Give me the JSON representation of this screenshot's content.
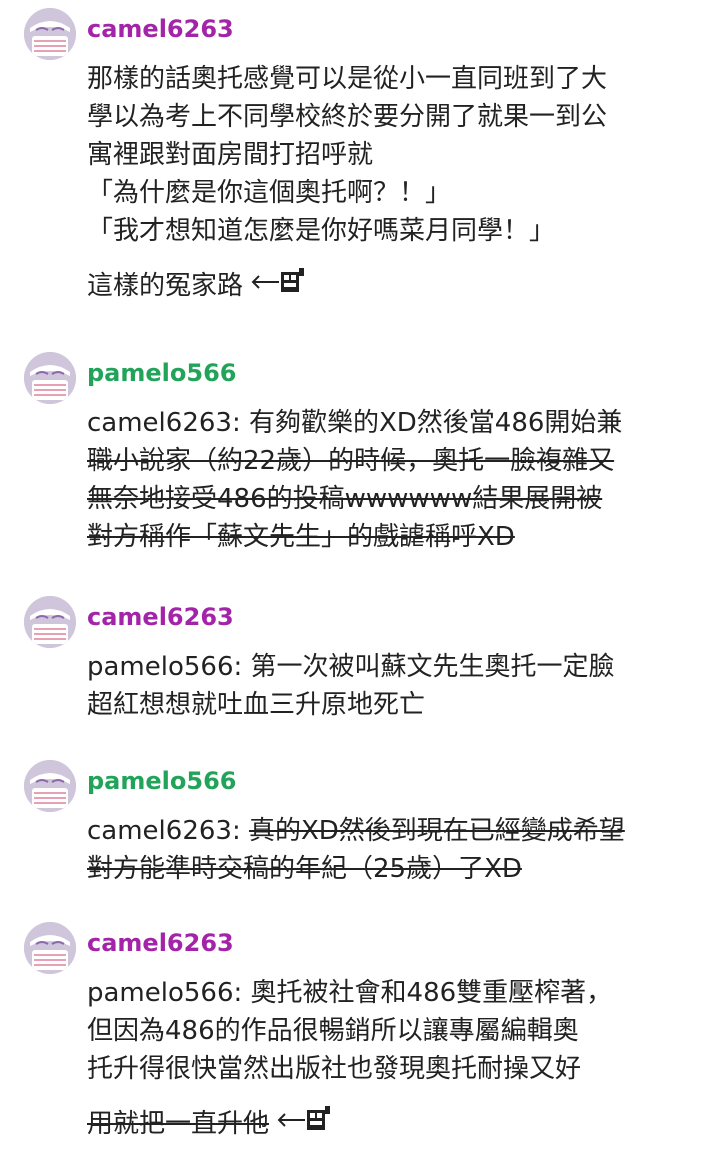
{
  "colors": {
    "camel": "#a324a9",
    "pamelo": "#22a35a",
    "avatar_bg": "#cfc6dc",
    "avatar_face": "#ffffff",
    "avatar_accent": "#e8a0b4"
  },
  "comments": [
    {
      "username": "camel6263",
      "lines": [
        "那樣的話奧托感覺可以是從小一直同班到了大",
        "學以為考上不同學校終於要分開了就果一到公",
        "寓裡跟對面房間打招呼就",
        "「為什麼是你這個奧托啊？！」",
        "「我才想知道怎麼是你好嗎菜月同學！」",
        "這樣的冤家路"
      ],
      "emote": "arrow-emote"
    },
    {
      "username": "pamelo566",
      "reply_to": "camel6263:",
      "lines": [
        "有夠歡樂的XD然後當486開始兼",
        "職小說家（約22歲）的時候，奧托一臉複雜又",
        "無奈地接受486的投稿wwwwww結果展開被",
        "對方稱作「蘇文先生」的戲謔稱呼XD"
      ]
    },
    {
      "username": "camel6263",
      "reply_to": "pamelo566:",
      "lines": [
        "第一次被叫蘇文先生奧托一定臉",
        "超紅想想就吐血三升原地死亡"
      ]
    },
    {
      "username": "pamelo566",
      "reply_to": "camel6263:",
      "lines": [
        "真的XD然後到現在已經變成希望",
        "對方能準時交稿的年紀（25歲）了XD"
      ]
    },
    {
      "username": "camel6263",
      "reply_to": "pamelo566:",
      "lines": [
        "奧托被社會和486雙重壓榨著，",
        "但因為486的作品很暢銷所以讓專屬編輯奧",
        "托升得很快當然出版社也發現奧托耐操又好",
        "用就把一直升他"
      ],
      "emote": "arrow-emote"
    }
  ]
}
